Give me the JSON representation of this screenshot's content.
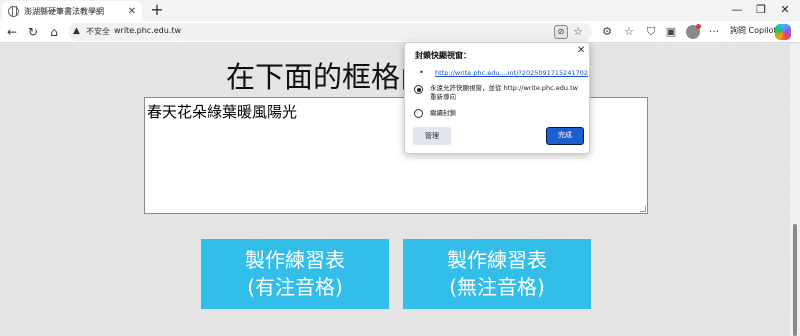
{
  "tab": {
    "title": "澎湖縣硬筆書法教學網",
    "close": "✕"
  },
  "newtab": "+",
  "window": {
    "minimize": "—",
    "maximize": "❐",
    "close": "✕"
  },
  "nav": {
    "back": "←",
    "reload": "↻",
    "home": "⌂"
  },
  "address": {
    "warning": "▲",
    "insecure_label": "不安全",
    "url": "write.phc.edu.tw"
  },
  "toolbar": {
    "copilot_label": "詢問 Copilot",
    "more": "···"
  },
  "page": {
    "title": "在下面的框格內",
    "textarea_value": "春天花朵綠葉暖風陽光",
    "button_zhuyin": {
      "line1": "製作練習表",
      "line2": "(有注音格)"
    },
    "button_no_zhuyin": {
      "line1": "製作練習表",
      "line2": "(無注音格)"
    }
  },
  "popup": {
    "title": "封鎖快顯視窗：",
    "bullet": "•",
    "link": "http://write.phc.edu....int/?2025091715241702",
    "option_allow_line1": "永遠允許快顯視窗，並從 http://write.phc.edu.tw",
    "option_allow_line2": "重新導向",
    "option_block": "繼續封鎖",
    "manage_label": "管理",
    "done_label": "完成",
    "selected_option": "allow"
  },
  "colors": {
    "button_bg": "#33bde9",
    "done_bg": "#1d5fd1",
    "link": "#1a4fc9"
  }
}
